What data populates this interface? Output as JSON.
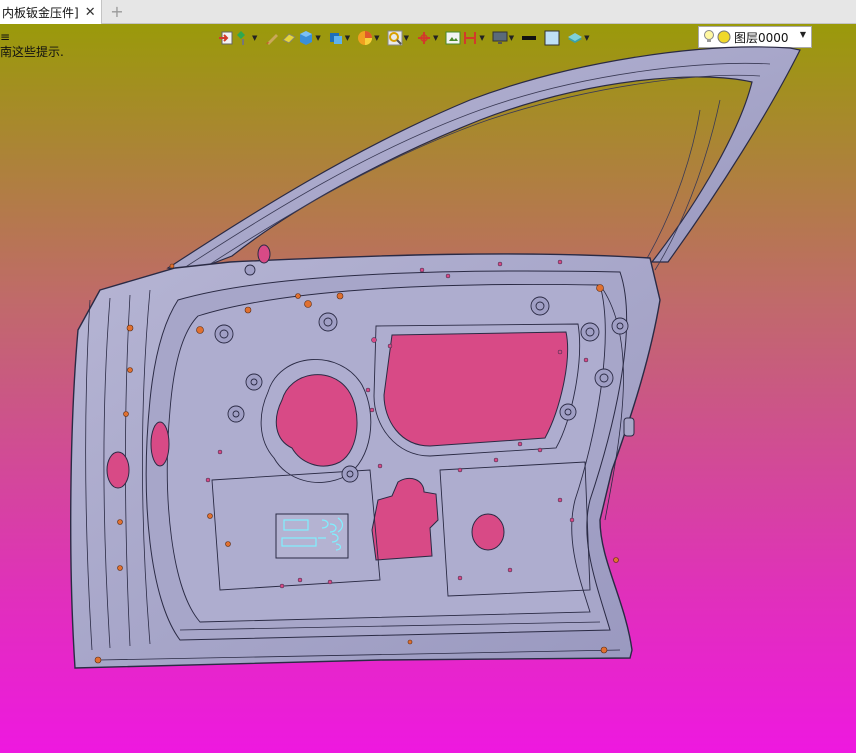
{
  "tab": {
    "title": "内板钣金压件]",
    "close_glyph": "✕",
    "new_glyph": "+"
  },
  "prompt": {
    "line1": "≡",
    "line2": "南这些提示."
  },
  "toolbar": {
    "icons": [
      "import-icon",
      "paint-icon",
      "brush-icon",
      "eraser-icon",
      "cube-icon",
      "box-view-icon",
      "color-wheel-icon",
      "zoom-icon",
      "axis-icon",
      "frame-icon",
      "section-icon",
      "monitor-icon",
      "line-icon",
      "square-icon",
      "layers-icon"
    ],
    "layer": {
      "label": "图层0000"
    }
  },
  "colors": {
    "panel": "#a8a7c8",
    "panel_dark": "#8d8cb2",
    "hole": "#d84a86",
    "accent": "#e07030",
    "text_highlight": "#7ff0ff"
  }
}
